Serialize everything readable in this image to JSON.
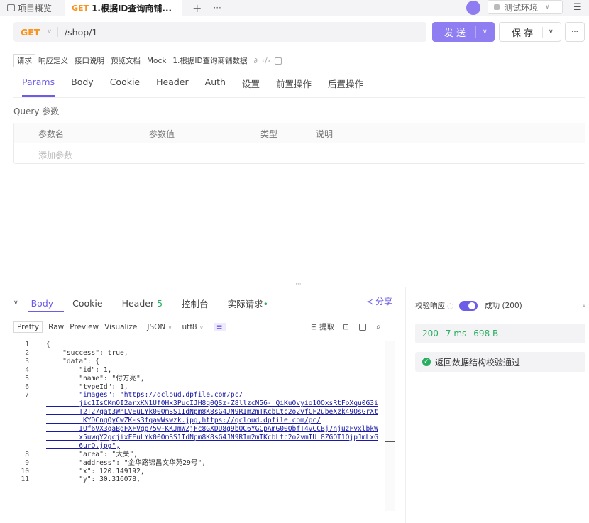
{
  "tabs": [
    {
      "label": "项目概览"
    },
    {
      "method": "GET",
      "label": "1.根据ID查询商铺..."
    }
  ],
  "env": {
    "label": "测试环境"
  },
  "request": {
    "method": "GET",
    "url": "/shop/1",
    "send": "发 送",
    "save": "保 存",
    "more": "···"
  },
  "sub_tabs": [
    "请求",
    "响应定义",
    "接口说明",
    "预览文档",
    "Mock",
    "1.根据ID查询商铺数据"
  ],
  "param_tabs": [
    "Params",
    "Body",
    "Cookie",
    "Header",
    "Auth",
    "设置",
    "前置操作",
    "后置操作"
  ],
  "query": {
    "title": "Query 参数",
    "headers": [
      "参数名",
      "参数值",
      "类型",
      "说明"
    ],
    "placeholder": "添加参数"
  },
  "response": {
    "tabs": [
      "Body",
      "Cookie",
      "Header",
      "控制台",
      "实际请求"
    ],
    "header_count": "5",
    "share": "分享",
    "formats": [
      "Pretty",
      "Raw",
      "Preview",
      "Visualize"
    ],
    "format_sel": "JSON",
    "encoding": "utf8",
    "extract": "提取"
  },
  "validate": {
    "label": "校验响应",
    "result": "成功 (200)",
    "status": "200",
    "time": "7 ms",
    "size": "698 B",
    "message": "返回数据结构校验通过"
  },
  "code_lines": [
    {
      "n": "1",
      "t": "{"
    },
    {
      "n": "2",
      "t": "    \"success\": true,"
    },
    {
      "n": "3",
      "t": "    \"data\": {"
    },
    {
      "n": "4",
      "t": "        \"id\": 1,"
    },
    {
      "n": "5",
      "t": "        \"name\": \"付方亮\","
    },
    {
      "n": "6",
      "t": "        \"typeId\": 1,"
    },
    {
      "n": "7",
      "t": "        \"images\": \"https://qcloud.dpfile.com/pc/"
    },
    {
      "n": "",
      "t": "        jic1IsCKmOI2arxKN1Uf0Hx3PucIJH8q0QSz-Z8llzcN56-_QiKuOvyio1OOxsRtFoXqu0G3i"
    },
    {
      "n": "",
      "t": "        T2T27qat3WhLVEuLYk00OmSS1IdNpm8K8sG4JN9RIm2mTKcbLtc2o2vfCF2ubeXzk49OsGrXt"
    },
    {
      "n": "",
      "t": "        _KYDCngOyCwZK-s3fqawWswzk.jpg,https://qcloud.dpfile.com/pc/"
    },
    {
      "n": "",
      "t": "        IOf6VX3qaBgFXFVgp75w-KKJmWZjFc8GXDU8g9bQC6YGCpAmG00QbfT4vCCBj7njuzFvxlbkW"
    },
    {
      "n": "",
      "t": "        x5uwqY2qcjixFEuLYk00OmSS1IdNpm8K8sG4JN9RIm2mTKcbLtc2o2vmIU_8ZGOT1OjpJmLxG"
    },
    {
      "n": "",
      "t": "        6urQ.jpg\","
    },
    {
      "n": "8",
      "t": "        \"area\": \"大关\","
    },
    {
      "n": "9",
      "t": "        \"address\": \"金华路锦昌文华苑29号\","
    },
    {
      "n": "10",
      "t": "        \"x\": 120.149192,"
    },
    {
      "n": "11",
      "t": "        \"y\": 30.316078,"
    }
  ]
}
